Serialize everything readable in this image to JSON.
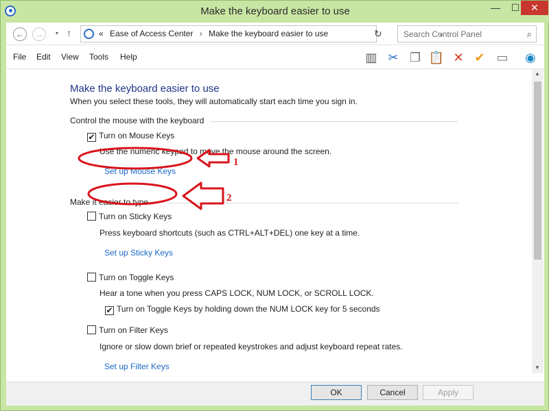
{
  "window": {
    "title": "Make the keyboard easier to use",
    "minimize": "—",
    "maximize": "☐",
    "close": "✕"
  },
  "address": {
    "history_glyph": "▾",
    "up_glyph": "↑",
    "prefix": "«",
    "crumbs": [
      "Ease of Access Center",
      "Make the keyboard easier to use"
    ],
    "separator": "›",
    "search_placeholder": "Search Control Panel"
  },
  "menu": {
    "items": [
      "File",
      "Edit",
      "View",
      "Tools",
      "Help"
    ]
  },
  "toolbar_icons": [
    "layout-icon",
    "cut-icon",
    "copy-icon",
    "paste-icon",
    "delete-icon",
    "check-icon",
    "properties-icon",
    "globe-icon"
  ],
  "page": {
    "heading": "Make the keyboard easier to use",
    "intro": "When you select these tools, they will automatically start each time you sign in.",
    "mouse_group": {
      "heading": "Control the mouse with the keyboard",
      "mouse_keys_label": "Turn on Mouse Keys",
      "mouse_keys_checked": true,
      "mouse_keys_desc": "Use the numeric keypad to move the mouse around the screen.",
      "mouse_keys_link": "Set up Mouse Keys"
    },
    "type_group": {
      "heading": "Make it easier to type",
      "sticky_label": "Turn on Sticky Keys",
      "sticky_checked": false,
      "sticky_desc": "Press keyboard shortcuts (such as CTRL+ALT+DEL) one key at a time.",
      "sticky_link": "Set up Sticky Keys",
      "toggle_label": "Turn on Toggle Keys",
      "toggle_checked": false,
      "toggle_desc": "Hear a tone when you press CAPS LOCK, NUM LOCK, or SCROLL LOCK.",
      "toggle_hold_label": "Turn on Toggle Keys by holding down the NUM LOCK key for 5 seconds",
      "toggle_hold_checked": true,
      "filter_label": "Turn on Filter Keys",
      "filter_checked": false,
      "filter_desc": "Ignore or slow down brief or repeated keystrokes and adjust keyboard repeat rates.",
      "filter_link": "Set up Filter Keys"
    }
  },
  "annotations": {
    "label_1": "1",
    "label_2": "2",
    "color": "#d9141c"
  },
  "buttons": {
    "ok": "OK",
    "cancel": "Cancel",
    "apply": "Apply"
  }
}
